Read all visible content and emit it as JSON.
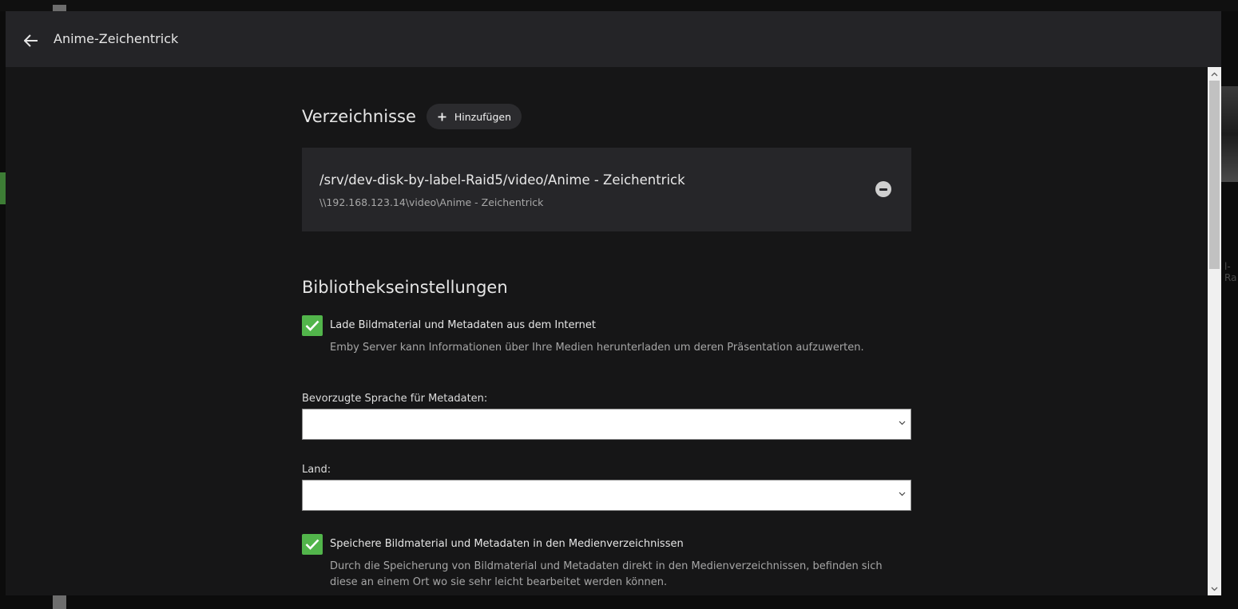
{
  "header": {
    "title": "Anime-Zeichentrick"
  },
  "folders": {
    "title": "Verzeichnisse",
    "add_label": "Hinzufügen",
    "items": [
      {
        "path": "/srv/dev-disk-by-label-Raid5/video/Anime - Zeichentrick",
        "share": "\\\\192.168.123.14\\video\\Anime - Zeichentrick"
      }
    ]
  },
  "library_settings": {
    "title": "Bibliothekseinstellungen",
    "download_metadata": {
      "checked": true,
      "label": "Lade Bildmaterial und Metadaten aus dem Internet",
      "description": "Emby Server kann Informationen über Ihre Medien herunterladen um deren Präsentation aufzuwerten."
    },
    "metadata_language": {
      "label": "Bevorzugte Sprache für Metadaten:",
      "value": ""
    },
    "country": {
      "label": "Land:",
      "value": ""
    },
    "save_local": {
      "checked": true,
      "label": "Speichere Bildmaterial und Metadaten in den Medienverzeichnissen",
      "description": "Durch die Speicherung von Bildmaterial und Metadaten direkt in den Medienverzeichnissen, befinden sich diese an einem Ort wo sie sehr leicht bearbeitet werden können."
    }
  },
  "colors": {
    "accent": "#52b54b",
    "header_bg": "#242427",
    "dialog_bg": "#161617",
    "card_bg": "#262629"
  },
  "background": {
    "right_text": "l-Ra"
  }
}
